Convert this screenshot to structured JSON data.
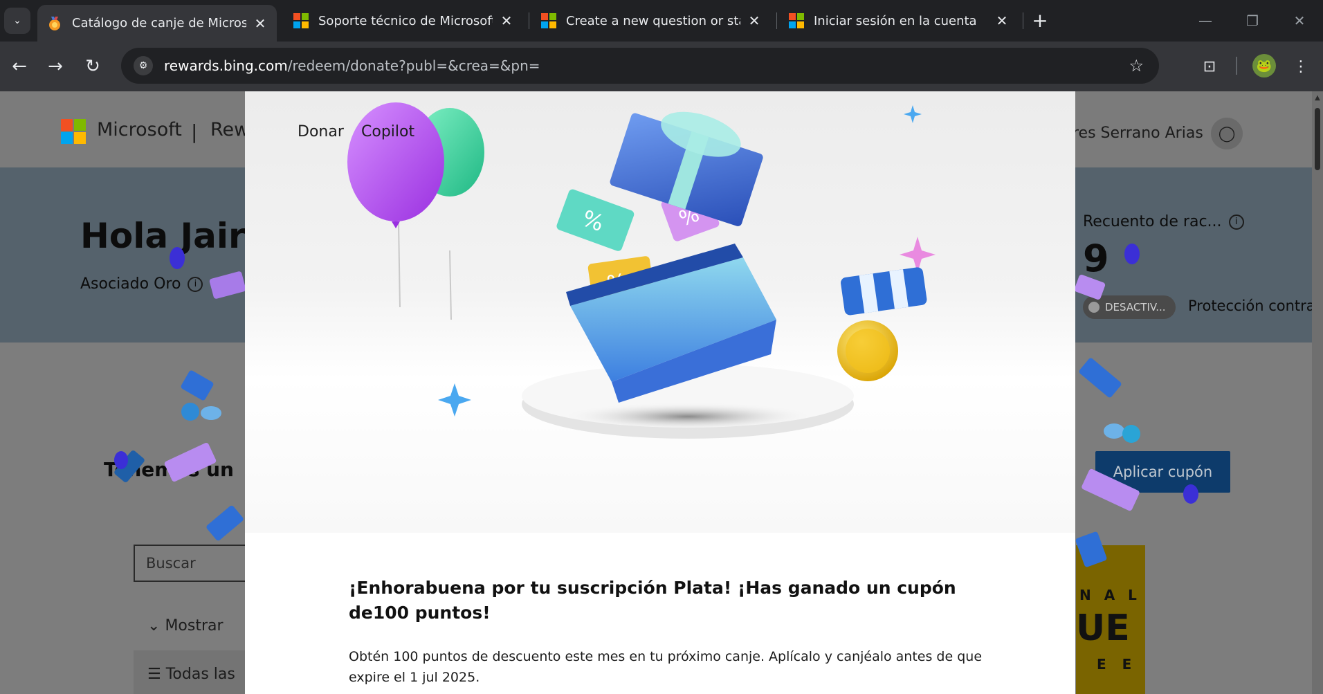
{
  "browser": {
    "tabs": [
      {
        "title": "Catálogo de canje de Microsoft",
        "active": true
      },
      {
        "title": "Soporte técnico de Microsoft",
        "active": false
      },
      {
        "title": "Create a new question or start a",
        "active": false
      },
      {
        "title": "Iniciar sesión en la cuenta",
        "active": false
      }
    ],
    "url": {
      "host": "rewards.bing.com",
      "path": "/redeem/donate?publ=&crea=&pn="
    }
  },
  "page": {
    "brand": "Microsoft",
    "separator": "|",
    "section": "Rew",
    "user_name": "res Serrano Arias",
    "greeting": "Hola Jairo",
    "level": "Asociado Oro",
    "streak_title": "Recuento de rac...",
    "streak_value": "9",
    "toggle_label": "DESACTIV...",
    "protection_label": "Protección contra l",
    "coupon_text": "Tenemos un",
    "apply_coupon_label": "Aplicar cupón",
    "search_placeholder": "Buscar",
    "show_label": "Mostrar",
    "all_label": "Todas las",
    "promo": {
      "line1": "N A L",
      "line2": "UE",
      "line3": "E E"
    }
  },
  "modal": {
    "nav": [
      "Donar",
      "Copilot"
    ],
    "title": "¡Enhorabuena por tu suscripción Plata! ¡Has ganado un cupón de100 puntos!",
    "description": "Obtén 100 puntos de descuento este mes en tu próximo canje. Aplícalo y canjéalo antes de que expire el 1 jul 2025."
  },
  "colors": {
    "chrome_bg": "#202124",
    "toolbar_bg": "#35363a",
    "apply_button": "#0d3b6b",
    "balloon_purple": "#b44cf0",
    "balloon_green": "#36d39a",
    "coin_gold": "#f3c21b"
  },
  "icons": [
    "tab-search-icon",
    "close-icon",
    "new-tab-icon",
    "minimize-icon",
    "restore-icon",
    "window-close-icon",
    "back-icon",
    "forward-icon",
    "reload-icon",
    "site-info-icon",
    "bookmark-star-icon",
    "screenshot-icon",
    "profile-avatar",
    "menu-kebab-icon",
    "info-icon",
    "user-icon"
  ]
}
